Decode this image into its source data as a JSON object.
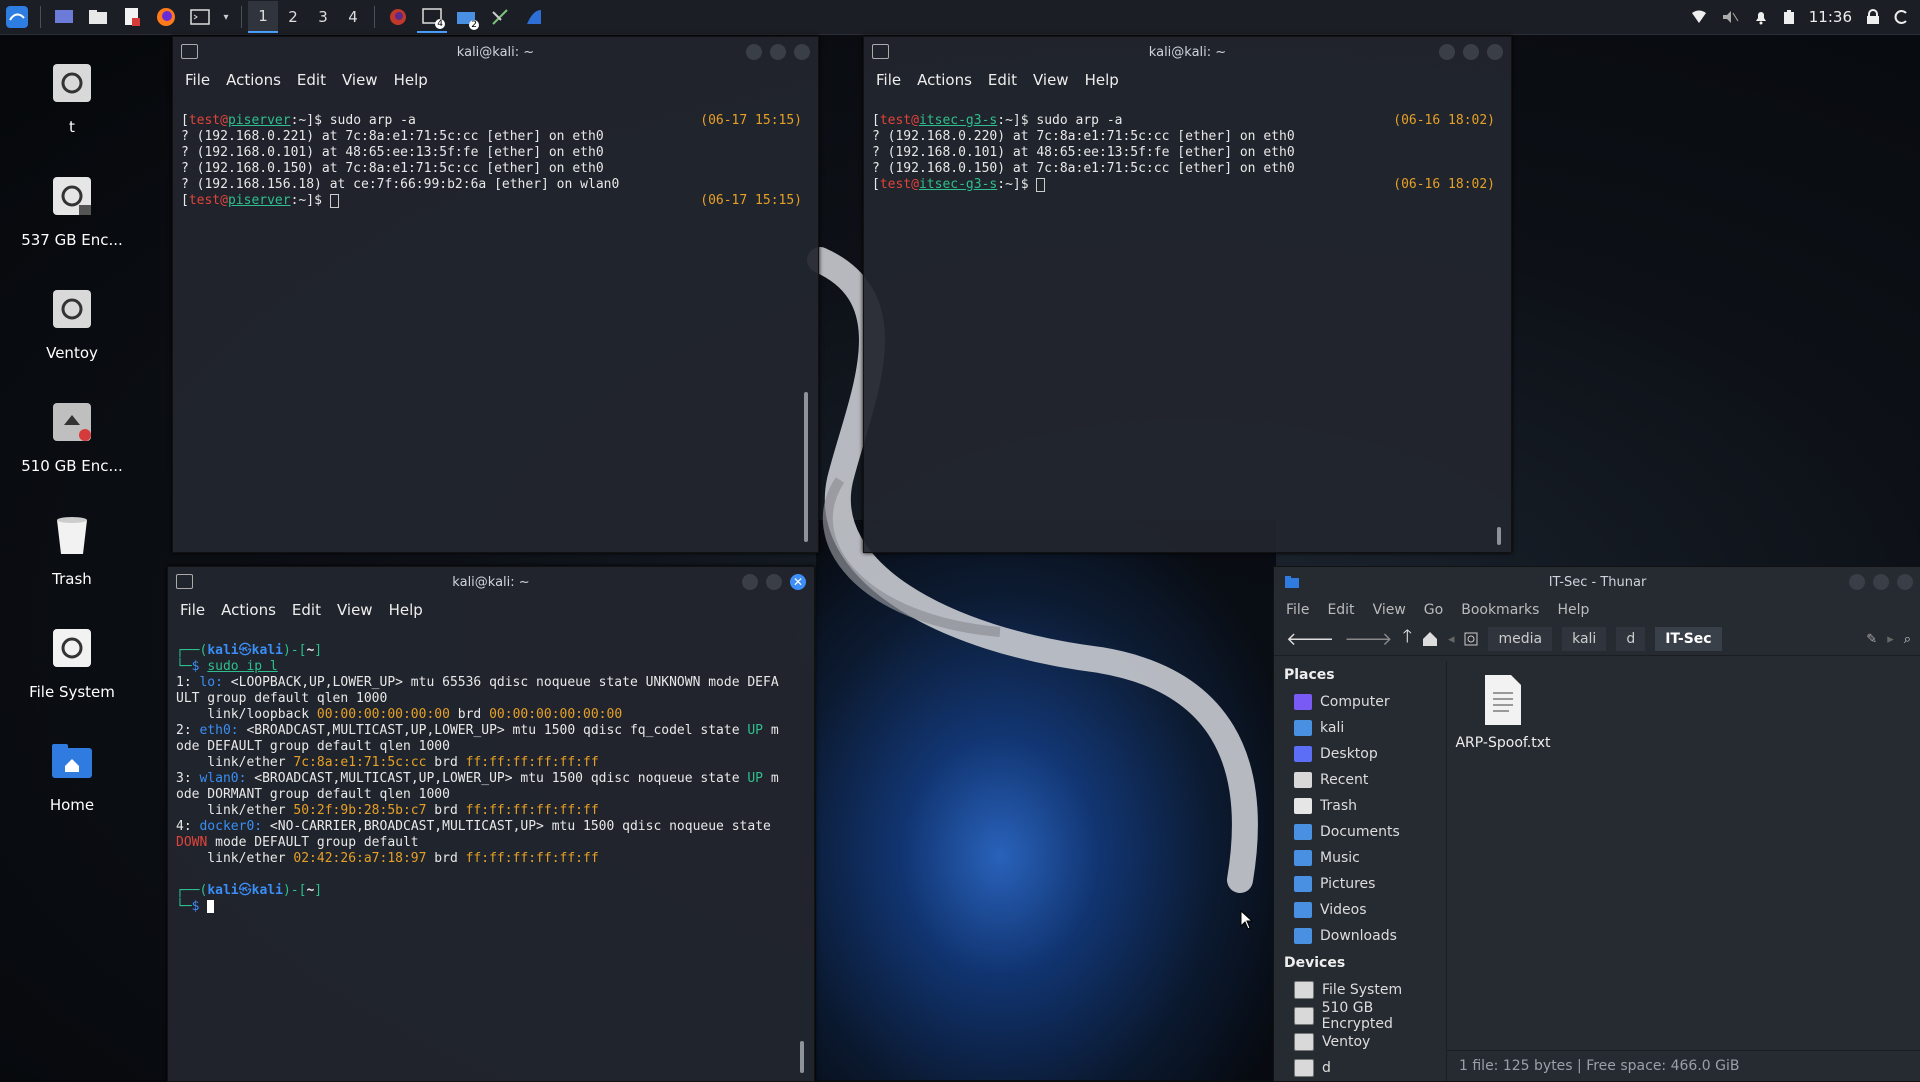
{
  "taskbar": {
    "workspaces": [
      "1",
      "2",
      "3",
      "4"
    ],
    "clock": "11:36",
    "terminal_badge": "4",
    "files_badge": "2"
  },
  "desktop": {
    "icons": [
      {
        "label": "t"
      },
      {
        "label": "537 GB Enc..."
      },
      {
        "label": "Ventoy"
      },
      {
        "label": "510 GB Enc..."
      },
      {
        "label": "Trash"
      },
      {
        "label": "File System"
      },
      {
        "label": "Home"
      }
    ]
  },
  "term_menu": [
    "File",
    "Actions",
    "Edit",
    "View",
    "Help"
  ],
  "term1": {
    "title": "kali@kali: ~",
    "cmd_user": "test",
    "cmd_at": "@",
    "cmd_host": "piserver",
    "cmd_path": ":~]$",
    "cmd": " sudo arp -a",
    "ts1": "(06-17 15:15)",
    "lines": [
      "? (192.168.0.221) at 7c:8a:e1:71:5c:cc [ether] on eth0",
      "? (192.168.0.101) at 48:65:ee:13:5f:fe [ether] on eth0",
      "? (192.168.0.150) at 7c:8a:e1:71:5c:cc [ether] on eth0",
      "? (192.168.156.18) at ce:7f:66:99:b2:6a [ether] on wlan0"
    ],
    "ts2": "(06-17 15:15)"
  },
  "term2": {
    "title": "kali@kali: ~",
    "cmd_user": "test",
    "cmd_at": "@",
    "cmd_host": "itsec-g3-s",
    "cmd_path": ":~]$",
    "cmd": " sudo arp -a",
    "ts1": "(06-16 18:02)",
    "lines": [
      "? (192.168.0.220) at 7c:8a:e1:71:5c:cc [ether] on eth0",
      "? (192.168.0.101) at 48:65:ee:13:5f:fe [ether] on eth0",
      "? (192.168.0.150) at 7c:8a:e1:71:5c:cc [ether] on eth0"
    ],
    "ts2": "(06-16 18:02)"
  },
  "term3": {
    "title": "kali@kali: ~",
    "prompt_user": "kali",
    "prompt_host": "kali",
    "prompt_path": "~",
    "cmd": "sudo ip l",
    "out": {
      "l1a": "1: ",
      "l1b": "lo:",
      "l1c": " <LOOPBACK,UP,LOWER_UP> mtu 65536 qdisc noqueue state UNKNOWN mode DEFA",
      "l2": "ULT group default qlen 1000",
      "l3a": "    link/loopback ",
      "l3b": "00:00:00:00:00:00",
      "l3c": " brd ",
      "l3d": "00:00:00:00:00:00",
      "l4a": "2: ",
      "l4b": "eth0:",
      "l4c": " <BROADCAST,MULTICAST,UP,LOWER_UP> mtu 1500 qdisc fq_codel state ",
      "l4d": "UP",
      "l4e": " m",
      "l5": "ode DEFAULT group default qlen 1000",
      "l6a": "    link/ether ",
      "l6b": "7c:8a:e1:71:5c:cc",
      "l6c": " brd ",
      "l6d": "ff:ff:ff:ff:ff:ff",
      "l7a": "3: ",
      "l7b": "wlan0:",
      "l7c": " <BROADCAST,MULTICAST,UP,LOWER_UP> mtu 1500 qdisc noqueue state ",
      "l7d": "UP",
      "l7e": " m",
      "l8": "ode DORMANT group default qlen 1000",
      "l9a": "    link/ether ",
      "l9b": "50:2f:9b:28:5b:c7",
      "l9c": " brd ",
      "l9d": "ff:ff:ff:ff:ff:ff",
      "l10a": "4: ",
      "l10b": "docker0:",
      "l10c": " <NO-CARRIER,BROADCAST,MULTICAST,UP> mtu 1500 qdisc noqueue state",
      "l11a": "DOWN",
      "l11b": " mode DEFAULT group default",
      "l12a": "    link/ether ",
      "l12b": "02:42:26:a7:18:97",
      "l12c": " brd ",
      "l12d": "ff:ff:ff:ff:ff:ff"
    }
  },
  "thunar": {
    "title": "IT-Sec - Thunar",
    "menu": [
      "File",
      "Edit",
      "View",
      "Go",
      "Bookmarks",
      "Help"
    ],
    "crumbs": [
      "media",
      "kali",
      "d",
      "IT-Sec"
    ],
    "places_heading": "Places",
    "places": [
      {
        "label": "Computer",
        "color": "#7a5af5"
      },
      {
        "label": "kali",
        "color": "#4a90e2"
      },
      {
        "label": "Desktop",
        "color": "#5b6ef5"
      },
      {
        "label": "Recent",
        "color": "#d8d8d8"
      },
      {
        "label": "Trash",
        "color": "#e6e6e6"
      },
      {
        "label": "Documents",
        "color": "#4a90e2"
      },
      {
        "label": "Music",
        "color": "#4a90e2"
      },
      {
        "label": "Pictures",
        "color": "#4a90e2"
      },
      {
        "label": "Videos",
        "color": "#4a90e2"
      },
      {
        "label": "Downloads",
        "color": "#4a90e2"
      }
    ],
    "devices_heading": "Devices",
    "devices": [
      {
        "label": "File System"
      },
      {
        "label": "510 GB Encrypted"
      },
      {
        "label": "Ventoy"
      },
      {
        "label": "d"
      }
    ],
    "file": {
      "name": "ARP-Spoof.txt"
    },
    "status": "1 file: 125 bytes | Free space: 466.0 GiB"
  }
}
